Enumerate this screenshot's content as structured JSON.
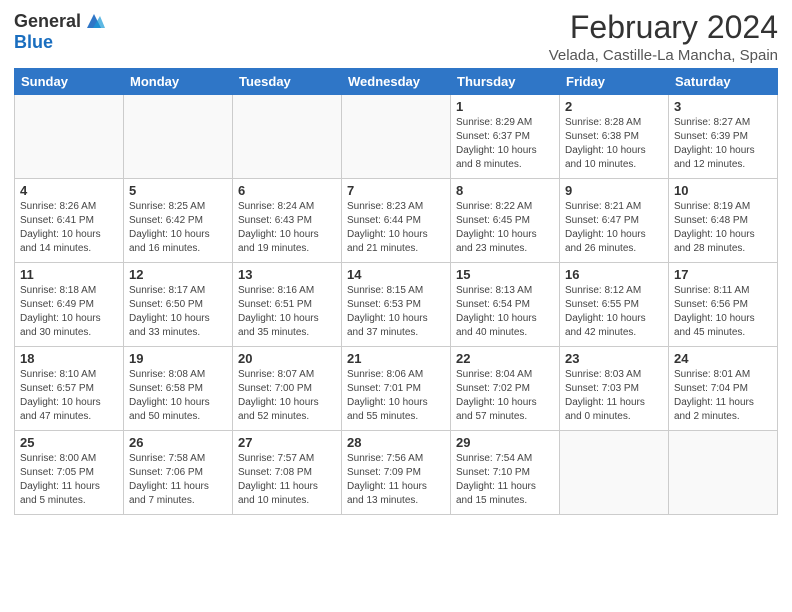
{
  "header": {
    "logo_general": "General",
    "logo_blue": "Blue",
    "month_year": "February 2024",
    "location": "Velada, Castille-La Mancha, Spain"
  },
  "days_of_week": [
    "Sunday",
    "Monday",
    "Tuesday",
    "Wednesday",
    "Thursday",
    "Friday",
    "Saturday"
  ],
  "weeks": [
    [
      {
        "day": "",
        "info": ""
      },
      {
        "day": "",
        "info": ""
      },
      {
        "day": "",
        "info": ""
      },
      {
        "day": "",
        "info": ""
      },
      {
        "day": "1",
        "info": "Sunrise: 8:29 AM\nSunset: 6:37 PM\nDaylight: 10 hours\nand 8 minutes."
      },
      {
        "day": "2",
        "info": "Sunrise: 8:28 AM\nSunset: 6:38 PM\nDaylight: 10 hours\nand 10 minutes."
      },
      {
        "day": "3",
        "info": "Sunrise: 8:27 AM\nSunset: 6:39 PM\nDaylight: 10 hours\nand 12 minutes."
      }
    ],
    [
      {
        "day": "4",
        "info": "Sunrise: 8:26 AM\nSunset: 6:41 PM\nDaylight: 10 hours\nand 14 minutes."
      },
      {
        "day": "5",
        "info": "Sunrise: 8:25 AM\nSunset: 6:42 PM\nDaylight: 10 hours\nand 16 minutes."
      },
      {
        "day": "6",
        "info": "Sunrise: 8:24 AM\nSunset: 6:43 PM\nDaylight: 10 hours\nand 19 minutes."
      },
      {
        "day": "7",
        "info": "Sunrise: 8:23 AM\nSunset: 6:44 PM\nDaylight: 10 hours\nand 21 minutes."
      },
      {
        "day": "8",
        "info": "Sunrise: 8:22 AM\nSunset: 6:45 PM\nDaylight: 10 hours\nand 23 minutes."
      },
      {
        "day": "9",
        "info": "Sunrise: 8:21 AM\nSunset: 6:47 PM\nDaylight: 10 hours\nand 26 minutes."
      },
      {
        "day": "10",
        "info": "Sunrise: 8:19 AM\nSunset: 6:48 PM\nDaylight: 10 hours\nand 28 minutes."
      }
    ],
    [
      {
        "day": "11",
        "info": "Sunrise: 8:18 AM\nSunset: 6:49 PM\nDaylight: 10 hours\nand 30 minutes."
      },
      {
        "day": "12",
        "info": "Sunrise: 8:17 AM\nSunset: 6:50 PM\nDaylight: 10 hours\nand 33 minutes."
      },
      {
        "day": "13",
        "info": "Sunrise: 8:16 AM\nSunset: 6:51 PM\nDaylight: 10 hours\nand 35 minutes."
      },
      {
        "day": "14",
        "info": "Sunrise: 8:15 AM\nSunset: 6:53 PM\nDaylight: 10 hours\nand 37 minutes."
      },
      {
        "day": "15",
        "info": "Sunrise: 8:13 AM\nSunset: 6:54 PM\nDaylight: 10 hours\nand 40 minutes."
      },
      {
        "day": "16",
        "info": "Sunrise: 8:12 AM\nSunset: 6:55 PM\nDaylight: 10 hours\nand 42 minutes."
      },
      {
        "day": "17",
        "info": "Sunrise: 8:11 AM\nSunset: 6:56 PM\nDaylight: 10 hours\nand 45 minutes."
      }
    ],
    [
      {
        "day": "18",
        "info": "Sunrise: 8:10 AM\nSunset: 6:57 PM\nDaylight: 10 hours\nand 47 minutes."
      },
      {
        "day": "19",
        "info": "Sunrise: 8:08 AM\nSunset: 6:58 PM\nDaylight: 10 hours\nand 50 minutes."
      },
      {
        "day": "20",
        "info": "Sunrise: 8:07 AM\nSunset: 7:00 PM\nDaylight: 10 hours\nand 52 minutes."
      },
      {
        "day": "21",
        "info": "Sunrise: 8:06 AM\nSunset: 7:01 PM\nDaylight: 10 hours\nand 55 minutes."
      },
      {
        "day": "22",
        "info": "Sunrise: 8:04 AM\nSunset: 7:02 PM\nDaylight: 10 hours\nand 57 minutes."
      },
      {
        "day": "23",
        "info": "Sunrise: 8:03 AM\nSunset: 7:03 PM\nDaylight: 11 hours\nand 0 minutes."
      },
      {
        "day": "24",
        "info": "Sunrise: 8:01 AM\nSunset: 7:04 PM\nDaylight: 11 hours\nand 2 minutes."
      }
    ],
    [
      {
        "day": "25",
        "info": "Sunrise: 8:00 AM\nSunset: 7:05 PM\nDaylight: 11 hours\nand 5 minutes."
      },
      {
        "day": "26",
        "info": "Sunrise: 7:58 AM\nSunset: 7:06 PM\nDaylight: 11 hours\nand 7 minutes."
      },
      {
        "day": "27",
        "info": "Sunrise: 7:57 AM\nSunset: 7:08 PM\nDaylight: 11 hours\nand 10 minutes."
      },
      {
        "day": "28",
        "info": "Sunrise: 7:56 AM\nSunset: 7:09 PM\nDaylight: 11 hours\nand 13 minutes."
      },
      {
        "day": "29",
        "info": "Sunrise: 7:54 AM\nSunset: 7:10 PM\nDaylight: 11 hours\nand 15 minutes."
      },
      {
        "day": "",
        "info": ""
      },
      {
        "day": "",
        "info": ""
      }
    ]
  ]
}
